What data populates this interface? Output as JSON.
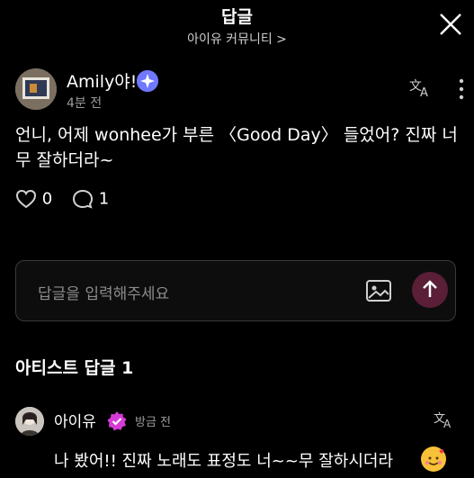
{
  "header": {
    "title": "답글",
    "community_link": "아이유 커뮤니티 >"
  },
  "post": {
    "author": "Amily야!",
    "time": "4분 전",
    "text": "언니, 어제 wonhee가 부른 〈Good Day〉 들었어? 진짜 너무 잘하더라~",
    "likes": "0",
    "comments": "1",
    "icons": {
      "verified_badge": "sparkle-badge-icon",
      "translate": "translate-icon",
      "more": "more-vertical-icon"
    }
  },
  "reply_input": {
    "placeholder": "답글을 입력해주세요"
  },
  "artist_replies": {
    "section_title": "아티스트 답글 1",
    "items": [
      {
        "name": "아이유",
        "time": "방금 전",
        "text": "나 봤어!! 진짜 노래도 표정도 너~~무 잘하시더라",
        "emoji": "smiling-face-with-hearts"
      }
    ]
  },
  "colors": {
    "background": "#000000",
    "verified_blue": "#6f78ff",
    "artist_badge_pink": "#d63bd6",
    "send_button": "#5a1e36"
  }
}
